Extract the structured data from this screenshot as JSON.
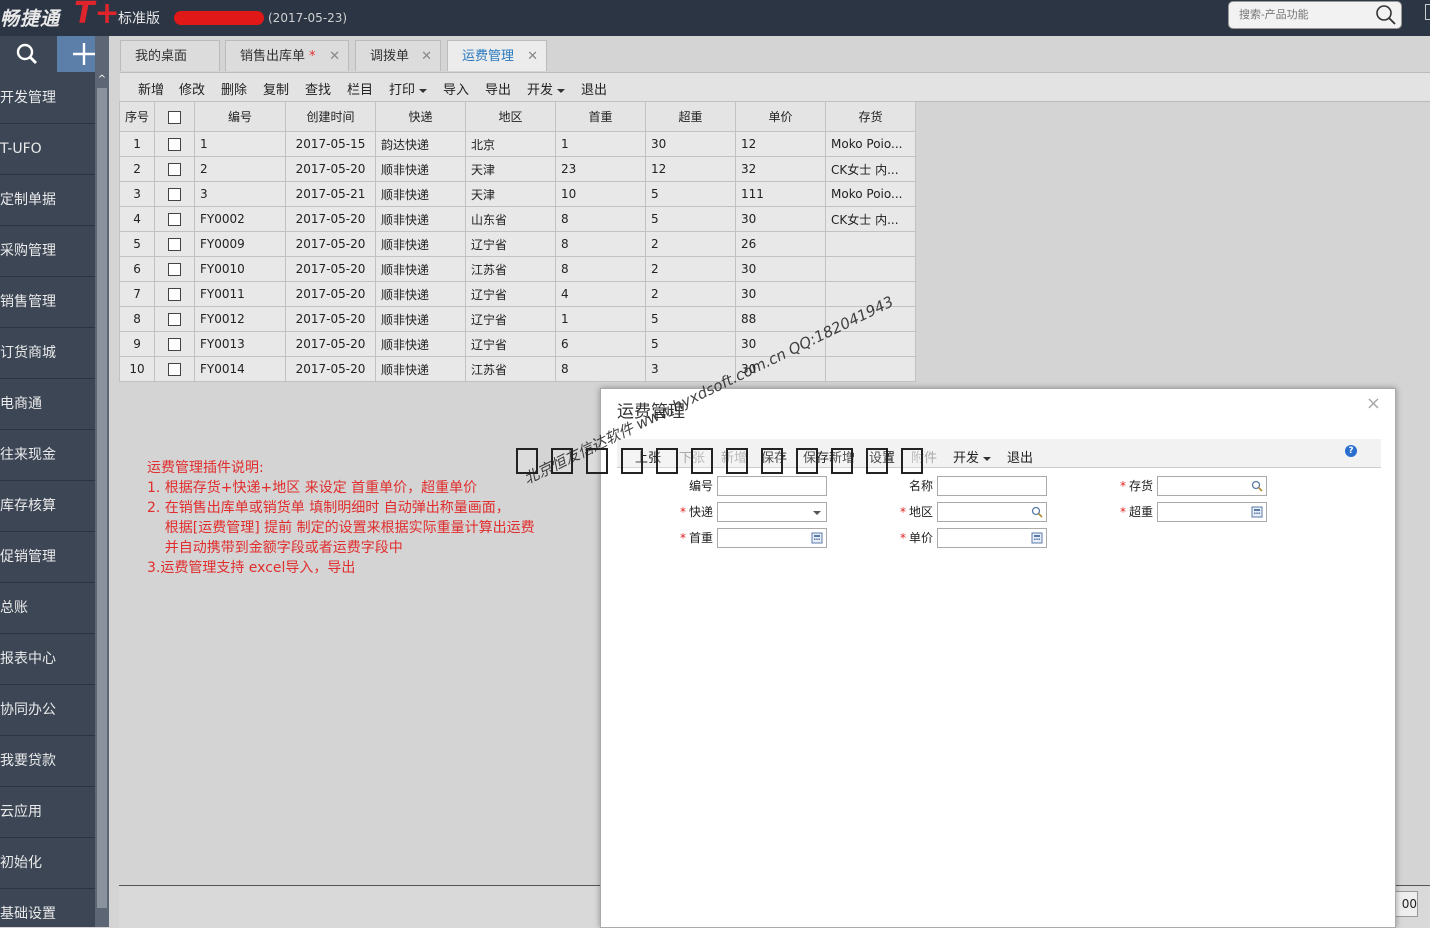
{
  "app": {
    "brand": "畅捷通",
    "brand_mark": "T+",
    "edition": "标准版",
    "date_version": "(2017-05-23)",
    "search_placeholder": "搜索-产品功能"
  },
  "sidebar": {
    "items": [
      "开发管理",
      "T-UFO",
      "定制单据",
      "采购管理",
      "销售管理",
      "订货商城",
      "电商通",
      "往来现金",
      "库存核算",
      "促销管理",
      "总账",
      "报表中心",
      "协同办公",
      "我要贷款",
      "云应用",
      "初始化",
      "基础设置"
    ]
  },
  "tabs": [
    {
      "label": "我的桌面",
      "closable": false,
      "active": false,
      "modified": false
    },
    {
      "label": "销售出库单",
      "closable": true,
      "active": false,
      "modified": true
    },
    {
      "label": "调拨单",
      "closable": true,
      "active": false,
      "modified": false
    },
    {
      "label": "运费管理",
      "closable": true,
      "active": true,
      "modified": false
    }
  ],
  "toolbar": {
    "new": "新增",
    "edit": "修改",
    "delete": "删除",
    "copy": "复制",
    "find": "查找",
    "columns": "栏目",
    "print": "打印",
    "import": "导入",
    "export": "导出",
    "dev": "开发",
    "exit": "退出"
  },
  "table": {
    "headers": [
      "序号",
      "",
      "编号",
      "创建时间",
      "快递",
      "地区",
      "首重",
      "超重",
      "单价",
      "存货"
    ],
    "rows": [
      [
        "1",
        "1",
        "2017-05-15",
        "韵达快递",
        "北京",
        "1",
        "30",
        "12",
        "Moko Poio..."
      ],
      [
        "2",
        "2",
        "2017-05-20",
        "顺非快递",
        "天津",
        "23",
        "12",
        "32",
        "CK女士 内..."
      ],
      [
        "3",
        "3",
        "2017-05-21",
        "顺非快递",
        "天津",
        "10",
        "5",
        "111",
        "Moko Poio..."
      ],
      [
        "4",
        "FY0002",
        "2017-05-20",
        "顺非快递",
        "山东省",
        "8",
        "5",
        "30",
        "CK女士 内..."
      ],
      [
        "5",
        "FY0009",
        "2017-05-20",
        "顺非快递",
        "辽宁省",
        "8",
        "2",
        "26",
        ""
      ],
      [
        "6",
        "FY0010",
        "2017-05-20",
        "顺非快递",
        "江苏省",
        "8",
        "2",
        "30",
        ""
      ],
      [
        "7",
        "FY0011",
        "2017-05-20",
        "顺非快递",
        "辽宁省",
        "4",
        "2",
        "30",
        ""
      ],
      [
        "8",
        "FY0012",
        "2017-05-20",
        "顺非快递",
        "辽宁省",
        "1",
        "5",
        "88",
        ""
      ],
      [
        "9",
        "FY0013",
        "2017-05-20",
        "顺非快递",
        "辽宁省",
        "6",
        "5",
        "30",
        ""
      ],
      [
        "10",
        "FY0014",
        "2017-05-20",
        "顺非快递",
        "江苏省",
        "8",
        "3",
        "30",
        ""
      ]
    ]
  },
  "description": {
    "lines": [
      "运费管理插件说明:",
      "1. 根据存货+快递+地区 来设定 首重单价，超重单价",
      "2. 在销售出库单或销货单 填制明细时 自动弹出称量画面，",
      "    根据[运费管理] 提前 制定的设置来根据实际重量计算出运费",
      "    并自动携带到金额字段或者运费字段中",
      "3.运费管理支持 excel导入，导出"
    ]
  },
  "watermark": "北京恒友信达软件 www.hyxdsoft.com.cn QQ:182041943",
  "pager": {
    "value": "00"
  },
  "modal": {
    "title": "运费管理",
    "close": "×",
    "toolbar": {
      "prev": "上张",
      "next": "下张",
      "new": "新增",
      "save": "保存",
      "save_new": "保存新增",
      "settings": "设置",
      "attach": "附件",
      "dev": "开发",
      "exit": "退出"
    },
    "fields": {
      "code": {
        "label": "编号",
        "required": false,
        "value": ""
      },
      "name": {
        "label": "名称",
        "required": false,
        "value": ""
      },
      "inventory": {
        "label": "存货",
        "required": true,
        "value": ""
      },
      "express": {
        "label": "快递",
        "required": true,
        "value": ""
      },
      "region": {
        "label": "地区",
        "required": true,
        "value": ""
      },
      "overweight": {
        "label": "超重",
        "required": true,
        "value": ""
      },
      "first_weight": {
        "label": "首重",
        "required": true,
        "value": ""
      },
      "unit_price": {
        "label": "单价",
        "required": true,
        "value": ""
      }
    }
  },
  "colors": {
    "topbar": "#2b3544",
    "sidebar": "#3c4655",
    "accent": "#2a7ac0",
    "note_red": "#e02e2e",
    "brand_red": "#e0242b"
  }
}
